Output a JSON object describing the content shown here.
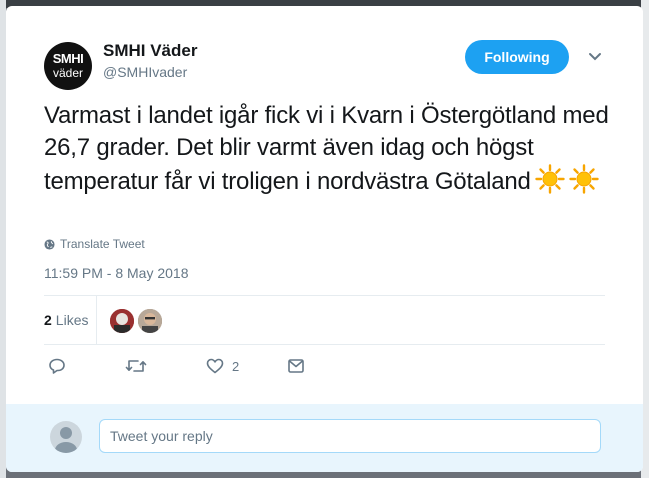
{
  "tweet": {
    "author_name": "SMHI Väder",
    "author_handle": "@SMHIvader",
    "avatar_line1": "SMHI",
    "avatar_line2": "väder",
    "follow_label": "Following",
    "text": "Varmast i landet igår fick vi i Kvarn i Östergötland med 26,7 grader. Det blir varmt även idag och högst temperatur får vi troligen i nordvästra Götaland",
    "emoji": "☀️☀️",
    "translate_label": "Translate Tweet",
    "timestamp": "11:59 PM - 8 May 2018",
    "likes_count": "2",
    "likes_label": "Likes",
    "like_action_count": "2"
  },
  "reply": {
    "placeholder": "Tweet your reply"
  },
  "colors": {
    "accent": "#1da1f2",
    "text_primary": "#14171a",
    "text_secondary": "#657786",
    "reply_bg": "#e8f5fd"
  },
  "icons": [
    "globe-icon",
    "reply-icon",
    "retweet-icon",
    "heart-icon",
    "message-icon",
    "chevron-down-icon",
    "sun-icon"
  ]
}
